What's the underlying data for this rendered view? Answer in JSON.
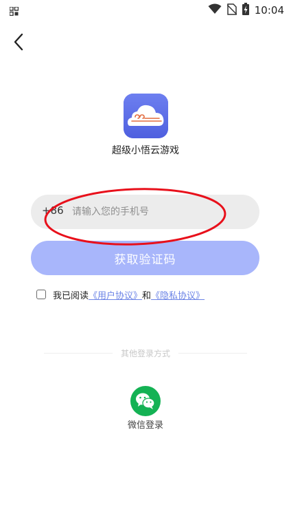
{
  "status_bar": {
    "time": "10:04"
  },
  "app": {
    "name": "超级小悟云游戏",
    "logo_color": "#5c6ee8"
  },
  "login": {
    "country_code": "+86",
    "phone_placeholder": "请输入您的手机号",
    "get_code_label": "获取验证码",
    "button_color": "#a8b6fb",
    "agreement": {
      "prefix": "我已阅读",
      "user_agreement": "《用户协议》",
      "conjunction": "和",
      "privacy_policy": "《隐私协议》",
      "link_color": "#6b83e6"
    }
  },
  "other_login": {
    "divider_text": "其他登录方式",
    "wechat_label": "微信登录",
    "wechat_color": "#14b254"
  },
  "annotation": {
    "color": "#e8101b"
  }
}
